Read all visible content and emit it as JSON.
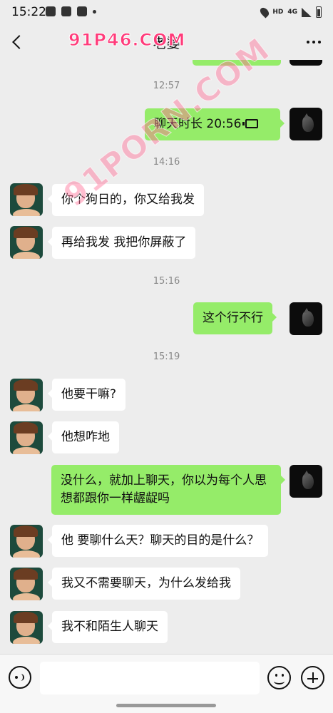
{
  "status_bar": {
    "time": "15:22",
    "network": "HD",
    "signal": "4G"
  },
  "header": {
    "title": "老婆",
    "watermark": "91P46.COM"
  },
  "watermark_overlay": "91PORN.COM",
  "messages": [
    {
      "type": "time",
      "text": "12:57"
    },
    {
      "type": "msg",
      "side": "right",
      "text": "聊天时长 20:56",
      "kind": "voice-call"
    },
    {
      "type": "time",
      "text": "14:16"
    },
    {
      "type": "msg",
      "side": "left",
      "text": "你个狗日的，你又给我发"
    },
    {
      "type": "msg",
      "side": "left",
      "text": "再给我发 我把你屏蔽了"
    },
    {
      "type": "time",
      "text": "15:16"
    },
    {
      "type": "msg",
      "side": "right",
      "text": "这个行不行"
    },
    {
      "type": "time",
      "text": "15:19"
    },
    {
      "type": "msg",
      "side": "left",
      "text": "他要干嘛?"
    },
    {
      "type": "msg",
      "side": "left",
      "text": "他想咋地"
    },
    {
      "type": "msg",
      "side": "right",
      "text": "没什么，就加上聊天，你以为每个人思想都跟你一样龌龊吗"
    },
    {
      "type": "msg",
      "side": "left",
      "text": "他 要聊什么天？聊天的目的是什么？"
    },
    {
      "type": "msg",
      "side": "left",
      "text": "我又不需要聊天，为什么发给我"
    },
    {
      "type": "msg",
      "side": "left",
      "text": "我不和陌生人聊天"
    }
  ],
  "input_bar": {
    "placeholder": ""
  },
  "colors": {
    "background": "#ededed",
    "bubble_sent": "#95ec69",
    "bubble_received": "#ffffff"
  }
}
